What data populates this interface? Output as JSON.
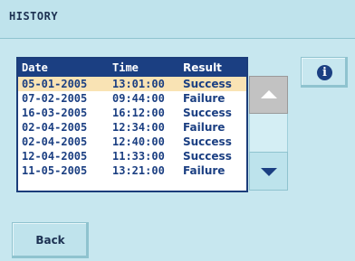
{
  "screen": {
    "title": "HISTORY"
  },
  "history": {
    "columns": [
      "Date",
      "Time",
      "Result"
    ],
    "selected_row": 0,
    "rows": [
      {
        "date": "05-01-2005",
        "time": "13:01:00",
        "result": "Success"
      },
      {
        "date": "07-02-2005",
        "time": "09:44:00",
        "result": "Failure"
      },
      {
        "date": "16-03-2005",
        "time": "16:12:00",
        "result": "Success"
      },
      {
        "date": "02-04-2005",
        "time": "12:34:00",
        "result": "Failure"
      },
      {
        "date": "02-04-2005",
        "time": "12:40:00",
        "result": "Success"
      },
      {
        "date": "12-04-2005",
        "time": "11:33:00",
        "result": "Success"
      },
      {
        "date": "11-05-2005",
        "time": "13:21:00",
        "result": "Failure"
      }
    ]
  },
  "icons": {
    "info": "info-icon",
    "scroll_up": "triangle-up-icon",
    "scroll_down": "triangle-down-icon"
  },
  "buttons": {
    "back_label": "Back"
  },
  "colors": {
    "panel": "#c7e7ef",
    "header": "#1b3f82",
    "selection": "#f9e3b4",
    "text": "#1b3f82"
  }
}
